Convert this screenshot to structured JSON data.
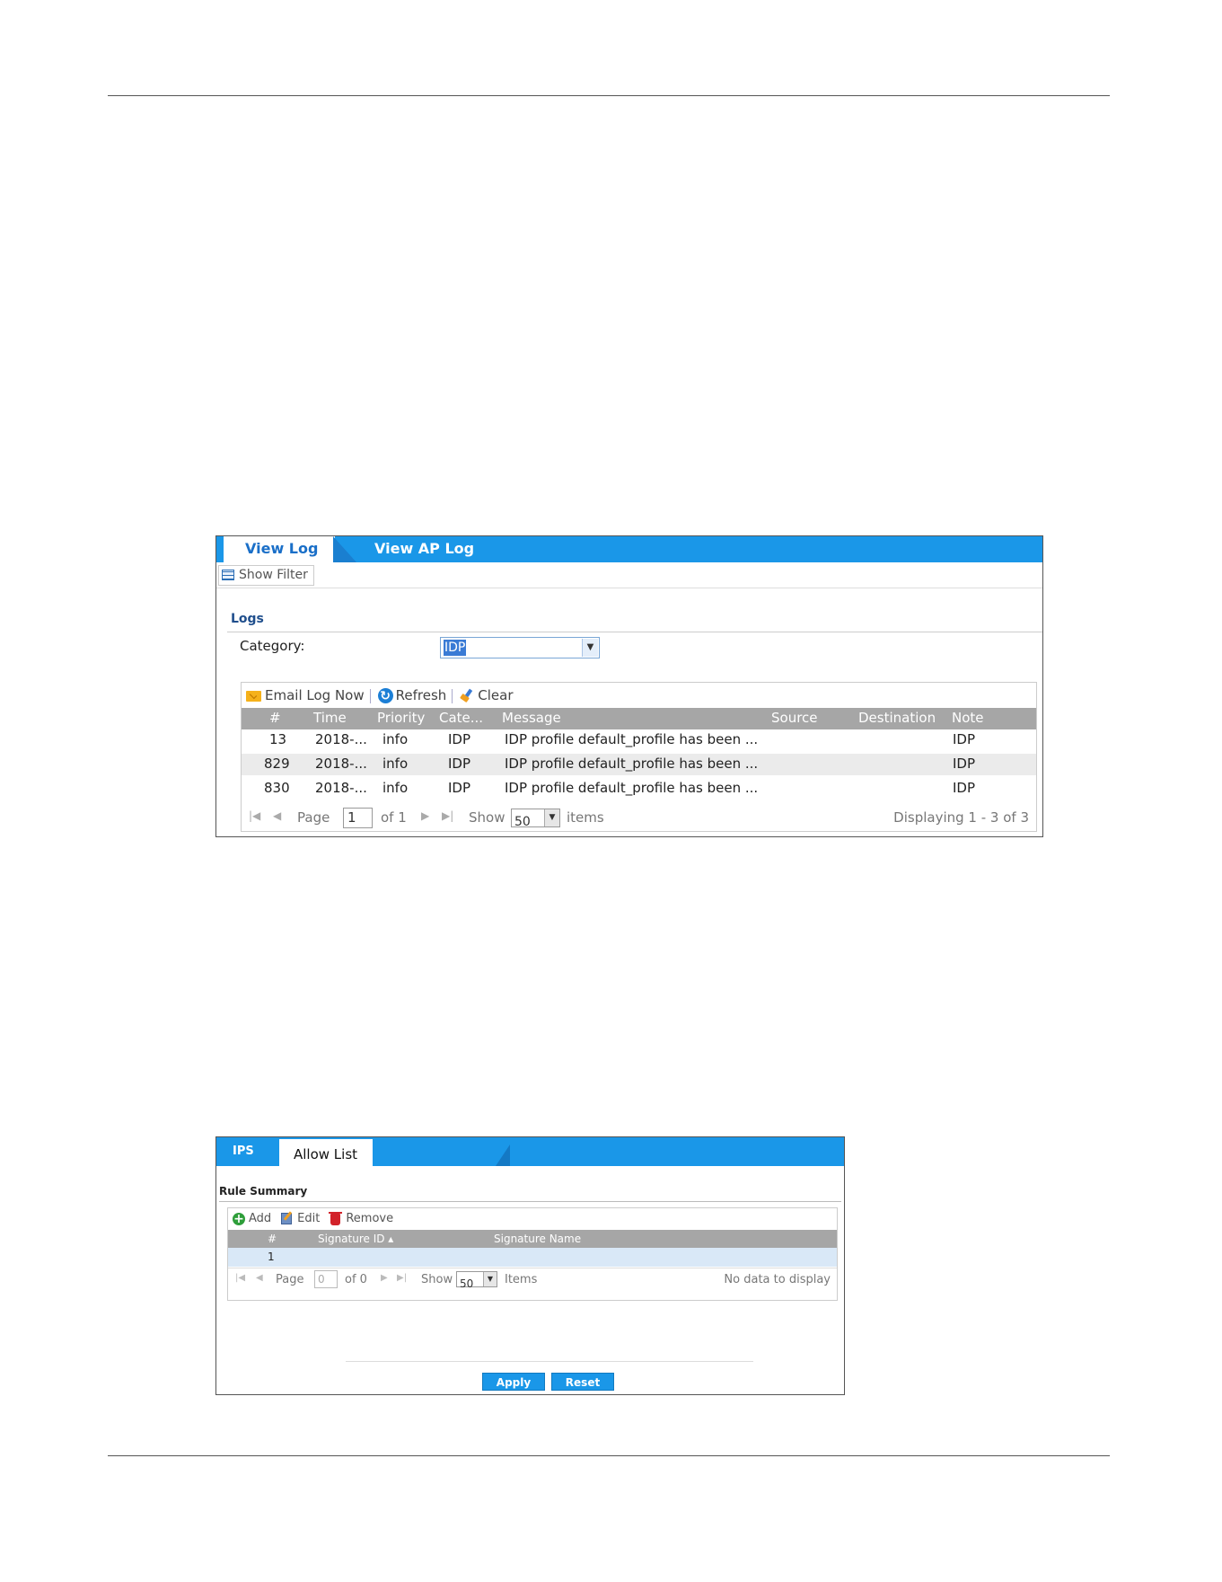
{
  "view_log_screen": {
    "tabs": [
      {
        "label": "View Log",
        "active": true
      },
      {
        "label": "View AP Log",
        "active": false
      }
    ],
    "show_filter_label": "Show Filter",
    "section_title": "Logs",
    "category_label": "Category:",
    "category_value": "IDP",
    "toolbar": {
      "email_label": "Email Log Now",
      "refresh_label": "Refresh",
      "clear_label": "Clear"
    },
    "columns": [
      "#",
      "Time",
      "Priority",
      "Cate...",
      "Message",
      "Source",
      "Destination",
      "Note"
    ],
    "rows": [
      {
        "num": "13",
        "time": "2018-...",
        "priority": "info",
        "category": "IDP",
        "message": "IDP profile default_profile has been ...",
        "source": "",
        "destination": "",
        "note": "IDP"
      },
      {
        "num": "829",
        "time": "2018-...",
        "priority": "info",
        "category": "IDP",
        "message": "IDP profile default_profile has been ...",
        "source": "",
        "destination": "",
        "note": "IDP"
      },
      {
        "num": "830",
        "time": "2018-...",
        "priority": "info",
        "category": "IDP",
        "message": "IDP profile default_profile has been ...",
        "source": "",
        "destination": "",
        "note": "IDP"
      }
    ],
    "pager": {
      "page_label": "Page",
      "page_value": "1",
      "of_label": "of 1",
      "show_label": "Show",
      "show_value": "50",
      "items_label": "items",
      "displaying": "Displaying 1 - 3 of 3"
    }
  },
  "allow_list_screen": {
    "tabs": [
      {
        "label": "IPS",
        "active": false
      },
      {
        "label": "Allow List",
        "active": true
      }
    ],
    "section_title": "Rule Summary",
    "toolbar": {
      "add_label": "Add",
      "edit_label": "Edit",
      "remove_label": "Remove"
    },
    "columns": [
      "#",
      "Signature ID ▴",
      "Signature Name"
    ],
    "rows": [
      {
        "num": "1",
        "signature_id": "",
        "signature_name": ""
      }
    ],
    "pager": {
      "page_label": "Page",
      "page_value": "0",
      "of_label": "of 0",
      "show_label": "Show",
      "show_value": "50",
      "items_label": "Items",
      "displaying": "No data to display"
    },
    "apply_label": "Apply",
    "reset_label": "Reset"
  },
  "colors": {
    "tab_bar": "#1a97e8",
    "header_row": "#a6a6a6",
    "selected_row": "#d9e8f7"
  }
}
